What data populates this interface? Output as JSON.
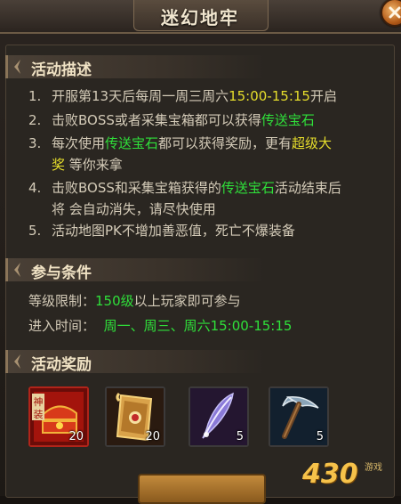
{
  "window": {
    "title": "迷幻地牢"
  },
  "sections": {
    "desc": {
      "label": "活动描述"
    },
    "cond": {
      "label": "参与条件"
    },
    "reward": {
      "label": "活动奖励"
    }
  },
  "description": [
    {
      "num": "1.",
      "parts": [
        {
          "text": "开服第13天后每周一周三周六",
          "c": ""
        },
        {
          "text": "15:00-15:15",
          "c": "y"
        },
        {
          "text": "开启",
          "c": ""
        }
      ]
    },
    {
      "num": "2.",
      "parts": [
        {
          "text": "击败BOSS或者采集宝箱都可以获得",
          "c": ""
        },
        {
          "text": "传送宝石",
          "c": "g"
        }
      ]
    },
    {
      "num": "3.",
      "parts": [
        {
          "text": "每次使用",
          "c": ""
        },
        {
          "text": "传送宝石",
          "c": "g"
        },
        {
          "text": "都可以获得奖励，更有",
          "c": ""
        },
        {
          "text": "超级大",
          "c": "y"
        }
      ]
    },
    {
      "num": "",
      "parts": [
        {
          "text": "奖",
          "c": "y"
        },
        {
          "text": "    等你来拿",
          "c": ""
        }
      ]
    },
    {
      "num": "4.",
      "parts": [
        {
          "text": "击败BOSS和采集宝箱获得的",
          "c": ""
        },
        {
          "text": "传送宝石",
          "c": "g"
        },
        {
          "text": "活动结束后",
          "c": ""
        }
      ]
    },
    {
      "num": "",
      "parts": [
        {
          "text": "将    会自动消失，请尽快使用",
          "c": ""
        }
      ]
    },
    {
      "num": "5.",
      "parts": [
        {
          "text": "活动地图PK不增加善恶值，死亡不爆装备",
          "c": ""
        }
      ]
    }
  ],
  "conditions": {
    "level_label": "等级限制：",
    "level_value": "150级",
    "level_suffix": "以上玩家即可参与",
    "time_label": "进入时间：",
    "time_value": "周一、周三、周六15:00-15:15"
  },
  "rewards": [
    {
      "icon": "red-chest-icon",
      "count": "20",
      "tag": "神装"
    },
    {
      "icon": "gold-scroll-icon",
      "count": "20"
    },
    {
      "icon": "blue-feather-icon",
      "count": "5"
    },
    {
      "icon": "pickaxe-icon",
      "count": "5"
    }
  ],
  "branding": {
    "logo": "430",
    "logo_suffix": "游戏"
  },
  "colors": {
    "green": "#2fe03a",
    "yellow": "#e6de2c",
    "text": "#d4cbb8",
    "header": "#f0e2c4"
  }
}
